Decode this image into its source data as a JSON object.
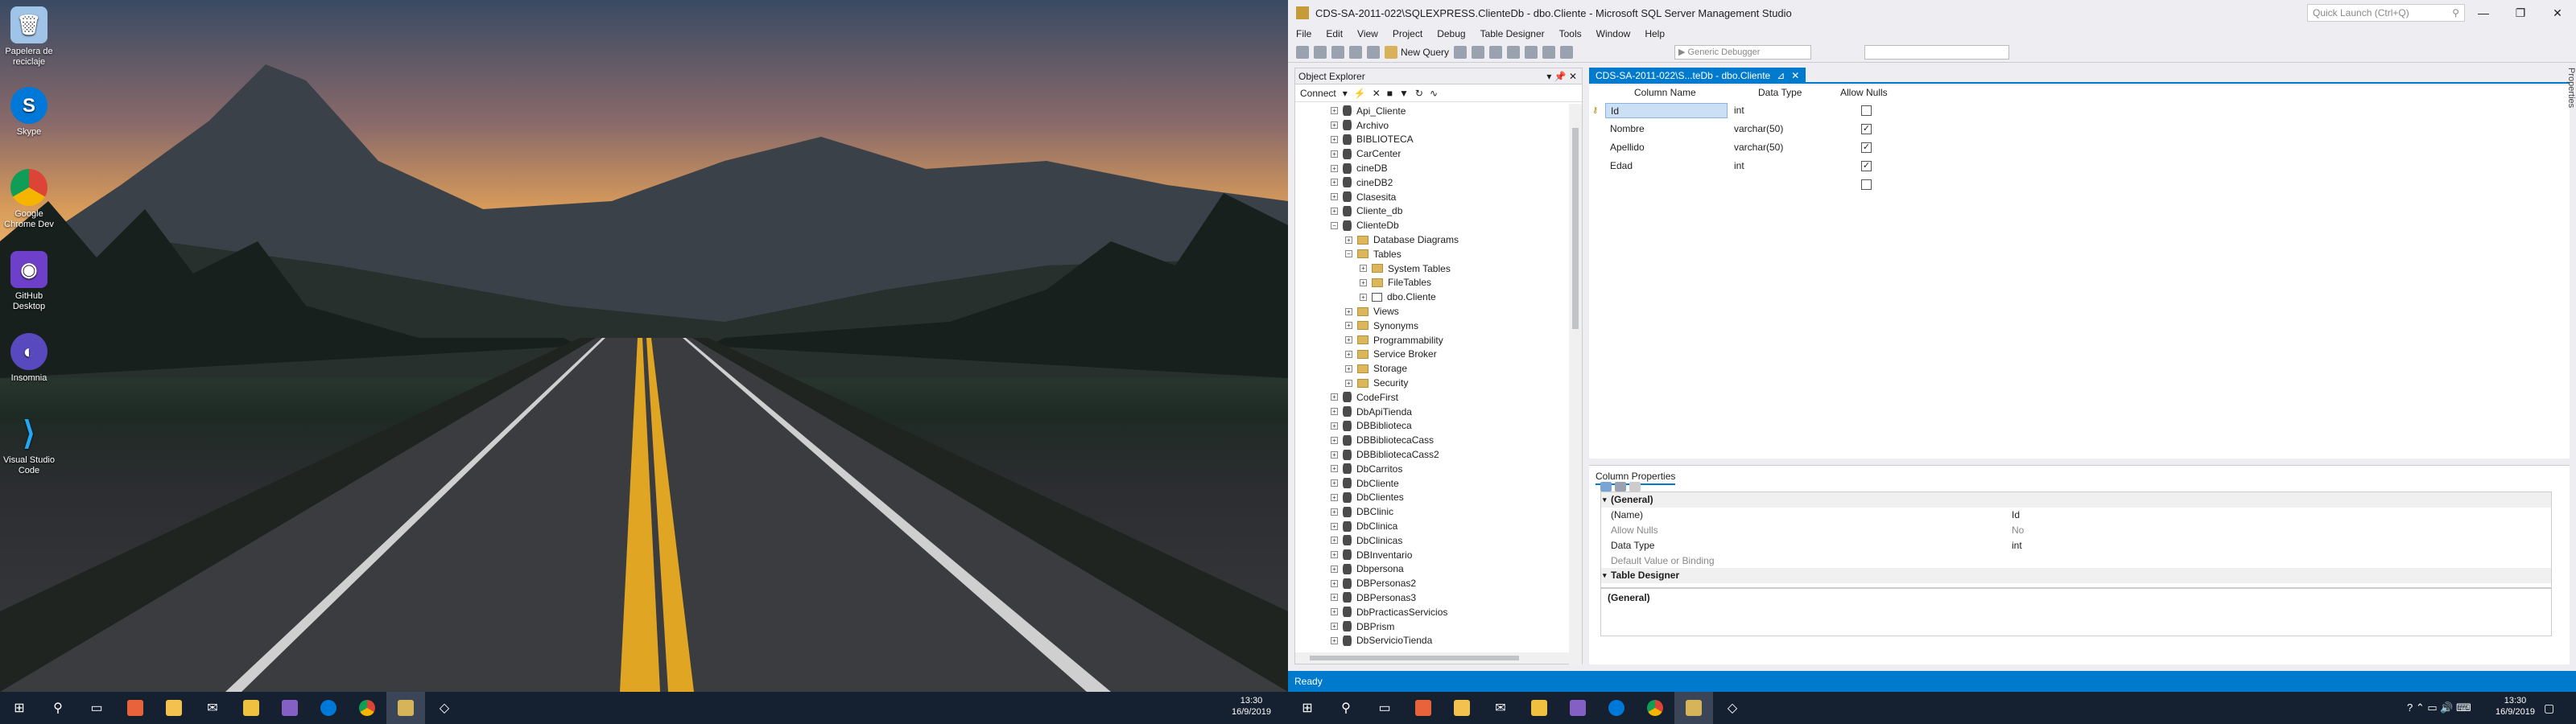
{
  "desktop": {
    "icons": [
      {
        "label": "Papelera de reciclaje",
        "icon": "recycle-bin-icon",
        "color": "#9fc4e8"
      },
      {
        "label": "Skype",
        "icon": "skype-icon",
        "color": "#0078d7"
      },
      {
        "label": "Google Chrome Dev",
        "icon": "chrome-dev-icon",
        "color": "#e8e8e8"
      },
      {
        "label": "GitHub Desktop",
        "icon": "github-desktop-icon",
        "color": "#6e40c9"
      },
      {
        "label": "Insomnia",
        "icon": "insomnia-icon",
        "color": "#5849be"
      },
      {
        "label": "Visual Studio Code",
        "icon": "vscode-icon",
        "color": "#007acc"
      }
    ]
  },
  "window": {
    "title": "CDS-SA-2011-022\\SQLEXPRESS.ClienteDb - dbo.Cliente - Microsoft SQL Server Management Studio",
    "quick_launch_placeholder": "Quick Launch (Ctrl+Q)",
    "menu": [
      "File",
      "Edit",
      "View",
      "Project",
      "Debug",
      "Table Designer",
      "Tools",
      "Window",
      "Help"
    ],
    "toolbar": {
      "new_query": "New Query",
      "debugger": "Generic Debugger"
    }
  },
  "object_explorer": {
    "title": "Object Explorer",
    "connect": "Connect",
    "nodes": [
      {
        "label": "Api_Cliente",
        "indent": 0,
        "type": "db",
        "exp": "+"
      },
      {
        "label": "Archivo",
        "indent": 0,
        "type": "db",
        "exp": "+"
      },
      {
        "label": "BIBLIOTECA",
        "indent": 0,
        "type": "db",
        "exp": "+"
      },
      {
        "label": "CarCenter",
        "indent": 0,
        "type": "db",
        "exp": "+"
      },
      {
        "label": "cineDB",
        "indent": 0,
        "type": "db",
        "exp": "+"
      },
      {
        "label": "cineDB2",
        "indent": 0,
        "type": "db",
        "exp": "+"
      },
      {
        "label": "Clasesita",
        "indent": 0,
        "type": "db",
        "exp": "+"
      },
      {
        "label": "Cliente_db",
        "indent": 0,
        "type": "db",
        "exp": "+"
      },
      {
        "label": "ClienteDb",
        "indent": 0,
        "type": "db",
        "exp": "-"
      },
      {
        "label": "Database Diagrams",
        "indent": 1,
        "type": "folder",
        "exp": "+"
      },
      {
        "label": "Tables",
        "indent": 1,
        "type": "folder",
        "exp": "-"
      },
      {
        "label": "System Tables",
        "indent": 2,
        "type": "folder",
        "exp": "+"
      },
      {
        "label": "FileTables",
        "indent": 2,
        "type": "folder",
        "exp": "+"
      },
      {
        "label": "dbo.Cliente",
        "indent": 2,
        "type": "table",
        "exp": "+"
      },
      {
        "label": "Views",
        "indent": 1,
        "type": "folder",
        "exp": "+"
      },
      {
        "label": "Synonyms",
        "indent": 1,
        "type": "folder",
        "exp": "+"
      },
      {
        "label": "Programmability",
        "indent": 1,
        "type": "folder",
        "exp": "+"
      },
      {
        "label": "Service Broker",
        "indent": 1,
        "type": "folder",
        "exp": "+"
      },
      {
        "label": "Storage",
        "indent": 1,
        "type": "folder",
        "exp": "+"
      },
      {
        "label": "Security",
        "indent": 1,
        "type": "folder",
        "exp": "+"
      },
      {
        "label": "CodeFirst",
        "indent": 0,
        "type": "db",
        "exp": "+"
      },
      {
        "label": "DbApiTienda",
        "indent": 0,
        "type": "db",
        "exp": "+"
      },
      {
        "label": "DBBiblioteca",
        "indent": 0,
        "type": "db",
        "exp": "+"
      },
      {
        "label": "DBBibliotecaCass",
        "indent": 0,
        "type": "db",
        "exp": "+"
      },
      {
        "label": "DBBibliotecaCass2",
        "indent": 0,
        "type": "db",
        "exp": "+"
      },
      {
        "label": "DbCarritos",
        "indent": 0,
        "type": "db",
        "exp": "+"
      },
      {
        "label": "DbCliente",
        "indent": 0,
        "type": "db",
        "exp": "+"
      },
      {
        "label": "DbClientes",
        "indent": 0,
        "type": "db",
        "exp": "+"
      },
      {
        "label": "DBClinic",
        "indent": 0,
        "type": "db",
        "exp": "+"
      },
      {
        "label": "DbClinica",
        "indent": 0,
        "type": "db",
        "exp": "+"
      },
      {
        "label": "DbClinicas",
        "indent": 0,
        "type": "db",
        "exp": "+"
      },
      {
        "label": "DBInventario",
        "indent": 0,
        "type": "db",
        "exp": "+"
      },
      {
        "label": "Dbpersona",
        "indent": 0,
        "type": "db",
        "exp": "+"
      },
      {
        "label": "DBPersonas2",
        "indent": 0,
        "type": "db",
        "exp": "+"
      },
      {
        "label": "DBPersonas3",
        "indent": 0,
        "type": "db",
        "exp": "+"
      },
      {
        "label": "DbPracticasServicios",
        "indent": 0,
        "type": "db",
        "exp": "+"
      },
      {
        "label": "DBPrism",
        "indent": 0,
        "type": "db",
        "exp": "+"
      },
      {
        "label": "DbServicioTienda",
        "indent": 0,
        "type": "db",
        "exp": "+"
      }
    ]
  },
  "designer": {
    "tab_title": "CDS-SA-2011-022\\S...teDb - dbo.Cliente",
    "headers": [
      "Column Name",
      "Data Type",
      "Allow Nulls"
    ],
    "rows": [
      {
        "name": "Id",
        "type": "int",
        "nulls": false,
        "key": true
      },
      {
        "name": "Nombre",
        "type": "varchar(50)",
        "nulls": true,
        "key": false
      },
      {
        "name": "Apellido",
        "type": "varchar(50)",
        "nulls": true,
        "key": false
      },
      {
        "name": "Edad",
        "type": "int",
        "nulls": true,
        "key": false
      },
      {
        "name": "",
        "type": "",
        "nulls": false,
        "key": false
      }
    ]
  },
  "column_properties": {
    "title": "Column Properties",
    "rows": [
      {
        "key": "(General)",
        "value": "",
        "cat": true
      },
      {
        "key": "(Name)",
        "value": "Id",
        "cat": false
      },
      {
        "key": "Allow Nulls",
        "value": "No",
        "cat": false,
        "grey": true
      },
      {
        "key": "Data Type",
        "value": "int",
        "cat": false
      },
      {
        "key": "Default Value or Binding",
        "value": "",
        "cat": false,
        "grey": true
      },
      {
        "key": "Table Designer",
        "value": "",
        "cat": true
      }
    ],
    "description": "(General)"
  },
  "properties_side": "Properties",
  "status": "Ready",
  "taskbar": {
    "left_time": "13:30",
    "left_date": "16/9/2019",
    "right_time": "13:30",
    "right_date": "16/9/2019"
  }
}
